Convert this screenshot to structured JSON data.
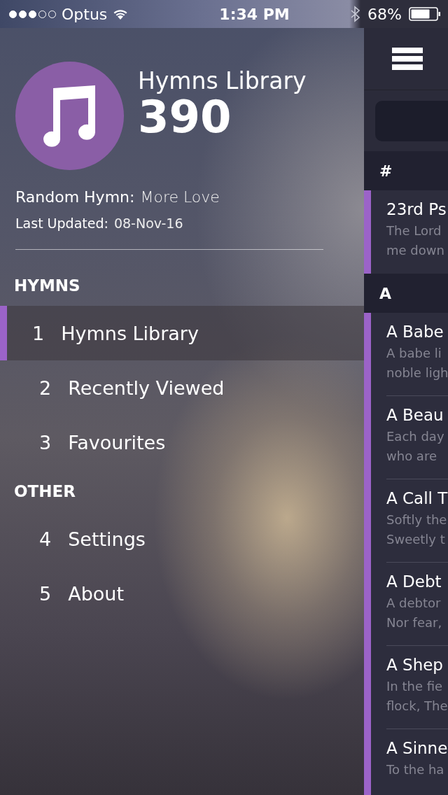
{
  "status_bar": {
    "carrier": "Optus",
    "time": "1:34 PM",
    "battery": "68%"
  },
  "library": {
    "title": "Hymns Library",
    "count": "390",
    "random_label": "Random Hymn:",
    "random_value": "More Love",
    "updated_label": "Last Updated:",
    "updated_value": "08-Nov-16"
  },
  "menu_sections": [
    {
      "heading": "HYMNS",
      "items": [
        {
          "number": "1",
          "label": "Hymns Library",
          "selected": true
        },
        {
          "number": "2",
          "label": "Recently Viewed",
          "selected": false
        },
        {
          "number": "3",
          "label": "Favourites",
          "selected": false
        }
      ]
    },
    {
      "heading": "OTHER",
      "items": [
        {
          "number": "4",
          "label": "Settings",
          "selected": false
        },
        {
          "number": "5",
          "label": "About",
          "selected": false
        }
      ]
    }
  ],
  "hymn_sections": [
    {
      "heading": "#",
      "hymns": [
        {
          "title": "23rd Ps",
          "preview": [
            "The Lord",
            "me down"
          ]
        }
      ]
    },
    {
      "heading": "A",
      "hymns": [
        {
          "title": "A Babe",
          "preview": [
            "A babe li",
            "noble ligh"
          ]
        },
        {
          "title": "A Beau",
          "preview": [
            "Each day",
            "who are"
          ]
        },
        {
          "title": "A Call T",
          "preview": [
            "Softly the",
            "Sweetly t"
          ]
        },
        {
          "title": "A Debt",
          "preview": [
            "A debtor",
            "Nor fear,"
          ]
        },
        {
          "title": "A Shep",
          "preview": [
            "In the fie",
            "flock, The"
          ]
        },
        {
          "title": "A Sinne",
          "preview": [
            "To the ha"
          ]
        }
      ]
    }
  ]
}
